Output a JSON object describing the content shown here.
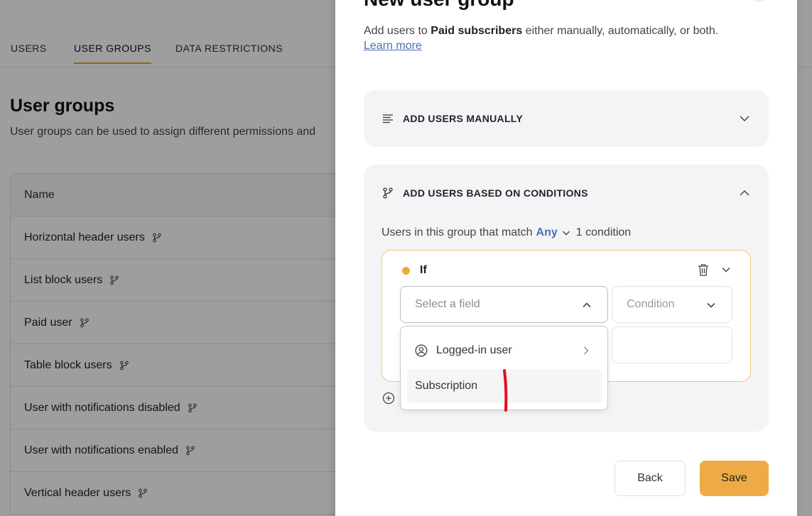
{
  "tabs": [
    {
      "label": "USERS",
      "active": false
    },
    {
      "label": "USER GROUPS",
      "active": true
    },
    {
      "label": "DATA RESTRICTIONS",
      "active": false
    }
  ],
  "page": {
    "title": "User groups",
    "description": "User groups can be used to assign different permissions and"
  },
  "table": {
    "header": "Name",
    "rows": [
      "Horizontal header users",
      "List block users",
      "Paid user",
      "Table block users",
      "User with notifications disabled",
      "User with notifications enabled",
      "Vertical header users"
    ]
  },
  "modal": {
    "title": "New user group",
    "desc_prefix": "Add users to ",
    "group_name": "Paid subscribers",
    "desc_suffix": " either manually, automatically, or both.",
    "learn_more": "Learn more",
    "section_manual": "ADD USERS MANUALLY",
    "section_conditions": "ADD USERS BASED ON CONDITIONS",
    "match_prefix": "Users in this group that match",
    "match_mode": "Any",
    "condition_count": "1 condition",
    "if_label": "If",
    "field_placeholder": "Select a field",
    "condition_placeholder": "Condition",
    "dropdown_items": [
      "Logged-in user",
      "Subscription"
    ],
    "back_label": "Back",
    "save_label": "Save"
  },
  "colors": {
    "accent": "#eeaa44",
    "link": "#4a6fb5",
    "condition_border": "#f2c47a",
    "annotation": "#e0101a"
  }
}
